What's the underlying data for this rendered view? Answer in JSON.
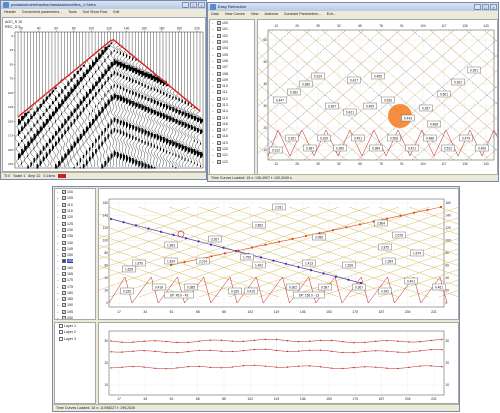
{
  "seismic_window": {
    "title": "pvdata/shot/refraction/rawdata/shotfiles_1.Sefra",
    "menu": [
      "Header",
      "Convenient parameters...",
      "Tools",
      "Sort Show Row",
      "Exit"
    ],
    "header_readouts": [
      "AGC_S 10",
      "REC_G 0"
    ],
    "x_ticks": [
      "20",
      "40",
      "60",
      "80",
      "100",
      "120",
      "140",
      "160",
      "180",
      "200",
      "220"
    ],
    "y_ticks": [
      "0",
      "25",
      "50",
      "75",
      "100",
      "125",
      "150",
      "175",
      "200",
      "225"
    ],
    "status": [
      "TI:0",
      "Scale 1",
      "Amp 12",
      "0.14ms"
    ],
    "status_indicator": "#cc2020",
    "trace_color": "#000000",
    "first_break_color": "#e02020"
  },
  "refraction_window": {
    "title": "Easy Refraction",
    "menu": [
      "Data",
      "View Curves",
      "View",
      "Antenna",
      "Constant Parameters...",
      "Exit..."
    ],
    "x_ticks": [
      "13",
      "26",
      "39",
      "52",
      "65",
      "78",
      "91",
      "104",
      "117",
      "130",
      "143"
    ],
    "y_ticks": [
      "10",
      "20",
      "30",
      "40",
      "50",
      "60"
    ],
    "list_items": [
      {
        "label": "100",
        "checked": true
      },
      {
        "label": "101",
        "checked": true
      },
      {
        "label": "102",
        "checked": true
      },
      {
        "label": "103",
        "checked": true
      },
      {
        "label": "104",
        "checked": true
      },
      {
        "label": "105",
        "checked": true
      },
      {
        "label": "106",
        "checked": true
      },
      {
        "label": "107",
        "checked": true
      },
      {
        "label": "108",
        "checked": true
      },
      {
        "label": "109",
        "checked": true
      },
      {
        "label": "110",
        "checked": true
      },
      {
        "label": "111",
        "checked": true
      },
      {
        "label": "112",
        "checked": true
      },
      {
        "label": "113",
        "checked": true
      },
      {
        "label": "114",
        "checked": true
      },
      {
        "label": "115",
        "checked": true
      },
      {
        "label": "116",
        "checked": true
      },
      {
        "label": "117",
        "checked": true
      },
      {
        "label": "118",
        "checked": true
      },
      {
        "label": "119",
        "checked": true
      },
      {
        "label": "120",
        "checked": true
      },
      {
        "label": "121",
        "checked": true
      },
      {
        "label": "122",
        "checked": true
      }
    ],
    "status": "Time Curves Loaded: 15  x: 136,4907  t: 100,3045 s",
    "labels": [
      "0.312",
      "0.351",
      "0.387",
      "0.329",
      "0.366",
      "0.451",
      "0.384",
      "0.508",
      "0.421",
      "0.488",
      "0.512",
      "0.479",
      "0.496",
      "0.447",
      "0.362",
      "0.386",
      "0.319",
      "0.397",
      "0.421",
      "0.459",
      "0.536",
      "0.443",
      "0.287",
      "0.561",
      "0.302",
      "0.391",
      "0.427",
      "0.455",
      "0.468"
    ],
    "highlight_color": "#f47a20"
  },
  "main_window": {
    "menu": [],
    "list_items": [
      {
        "label": "100",
        "checked": true,
        "selected": false
      },
      {
        "label": "105",
        "checked": true,
        "selected": false
      },
      {
        "label": "110",
        "checked": true,
        "selected": false
      },
      {
        "label": "115",
        "checked": true,
        "selected": false
      },
      {
        "label": "120",
        "checked": true,
        "selected": false
      },
      {
        "label": "125",
        "checked": true,
        "selected": false
      },
      {
        "label": "130",
        "checked": true,
        "selected": false
      },
      {
        "label": "135",
        "checked": true,
        "selected": false
      },
      {
        "label": "140",
        "checked": true,
        "selected": false
      },
      {
        "label": "145",
        "checked": true,
        "selected": false
      },
      {
        "label": "150",
        "checked": true,
        "selected": false
      },
      {
        "label": "155",
        "checked": true,
        "selected": true
      },
      {
        "label": "160",
        "checked": true,
        "selected": false
      },
      {
        "label": "165",
        "checked": true,
        "selected": false
      },
      {
        "label": "170",
        "checked": true,
        "selected": false
      },
      {
        "label": "175",
        "checked": true,
        "selected": false
      },
      {
        "label": "180",
        "checked": true,
        "selected": false
      },
      {
        "label": "185",
        "checked": true,
        "selected": false
      },
      {
        "label": "190",
        "checked": true,
        "selected": false
      },
      {
        "label": "195",
        "checked": true,
        "selected": false
      },
      {
        "label": "200",
        "checked": true,
        "selected": false
      }
    ],
    "layer_items": [
      "Layer 1",
      "Layer 2",
      "Layer 3"
    ],
    "upper_chart": {
      "x_ticks": [
        "17",
        "34",
        "51",
        "68",
        "85",
        "102",
        "119",
        "136",
        "153",
        "170",
        "187",
        "204",
        "221"
      ],
      "y_ticks_left": [
        "160",
        "140",
        "120",
        "100",
        "80",
        "60",
        "40",
        "20",
        "0"
      ],
      "y_ticks_right": [
        "160",
        "140",
        "120",
        "100",
        "80",
        "60",
        "40",
        "20",
        "0"
      ],
      "labels": [
        "2.031",
        "2.892",
        "2.864",
        "2.678",
        "2.875",
        "2.056",
        "1.963",
        "3.267",
        "1.876",
        "1.824",
        "2.014",
        "1.755",
        "1.492",
        "1.413",
        "1.528",
        "1.354",
        "1.674",
        "1.628",
        "0.335",
        "0.418",
        "0.385",
        "0.326",
        "0.415",
        "0.362",
        "0.387",
        "0.367",
        "0.342",
        "0.401",
        "0.461"
      ],
      "source_markers": [
        "SP: 45.0 - 43",
        "SP: 156.0 - 13"
      ],
      "colors": {
        "rising": "#e04a10",
        "falling": "#3a2ab0",
        "background": "#c8a020",
        "traveltime": "#c02020"
      }
    },
    "lower_chart": {
      "x_ticks": [
        "17",
        "34",
        "51",
        "68",
        "85",
        "102",
        "119",
        "136",
        "153",
        "170",
        "187",
        "204",
        "221"
      ],
      "y_ticks_left": [
        "30",
        "20",
        "10"
      ],
      "y_ticks_right": [
        "30",
        "20",
        "10"
      ],
      "layer_color": "#c02020"
    },
    "status": "Time Curves Loaded: 15  x: -6.098227  t: 195,2026"
  }
}
